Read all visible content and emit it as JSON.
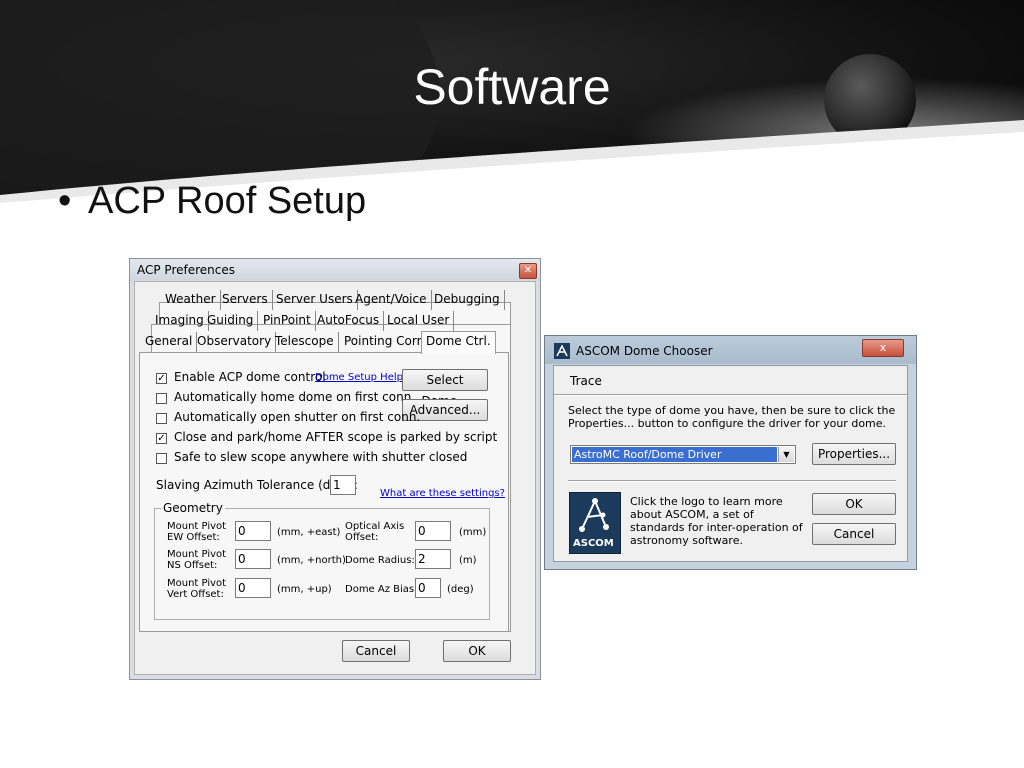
{
  "slide": {
    "title": "Software",
    "bullet": "ACP Roof Setup"
  },
  "acp": {
    "title": "ACP Preferences",
    "close_glyph": "✕",
    "tabs_row1": [
      "Weather",
      "Servers",
      "Server Users",
      "Agent/Voice",
      "Debugging"
    ],
    "tabs_row2": [
      "Imaging",
      "Guiding",
      "PinPoint",
      "AutoFocus",
      "Local User"
    ],
    "tabs_row3": [
      "General",
      "Observatory",
      "Telescope",
      "Pointing Corr.",
      "Dome Ctrl."
    ],
    "active_tab": "Dome Ctrl.",
    "options": [
      {
        "label": "Enable ACP dome control",
        "checked": true,
        "mark": "✓"
      },
      {
        "label": "Automatically home dome on first conn.",
        "checked": false,
        "mark": ""
      },
      {
        "label": "Automatically open shutter on first conn.",
        "checked": false,
        "mark": ""
      },
      {
        "label": "Close and park/home AFTER scope is parked by script",
        "checked": true,
        "mark": "✓"
      },
      {
        "label": "Safe to slew scope anywhere with shutter closed",
        "checked": false,
        "mark": ""
      }
    ],
    "dome_setup_help": "Dome Setup Help",
    "select_dome_button": "Select Dome...",
    "advanced_button": "Advanced...",
    "slaving_label": "Slaving Azimuth Tolerance (deg.):",
    "slaving_value": "1",
    "settings_link": "What are these settings?",
    "geometry": {
      "legend": "Geometry",
      "ew_label_1": "Mount Pivot",
      "ew_label_2": "EW Offset:",
      "ew_value": "0",
      "ew_unit": "(mm, +east)",
      "ns_label_1": "Mount Pivot",
      "ns_label_2": "NS Offset:",
      "ns_value": "0",
      "ns_unit": "(mm, +north)",
      "vert_label_1": "Mount Pivot",
      "vert_label_2": "Vert Offset:",
      "vert_value": "0",
      "vert_unit": "(mm, +up)",
      "axis_label_1": "Optical Axis",
      "axis_label_2": "Offset:",
      "axis_value": "0",
      "axis_unit": "(mm)",
      "radius_label": "Dome Radius:",
      "radius_value": "2",
      "radius_unit": "(m)",
      "bias_label": "Dome Az Bias:",
      "bias_value": "0",
      "bias_unit": "(deg)"
    },
    "cancel_button": "Cancel",
    "ok_button": "OK"
  },
  "ascom": {
    "title": "ASCOM Dome Chooser",
    "close_glyph": "x",
    "menu_trace": "Trace",
    "instructions_1": "Select the type of dome you have, then be sure to click the",
    "instructions_2": "Properties... button to configure the driver for your dome.",
    "driver_selected": "AstroMC Roof/Dome Driver",
    "dropdown_arrow": "▼",
    "properties_button": "Properties...",
    "logo_text": "ASCOM",
    "info_1": "Click the logo to learn more",
    "info_2": "about ASCOM, a set of",
    "info_3": "standards for inter-operation of",
    "info_4": "astronomy software.",
    "ok_button": "OK",
    "cancel_button": "Cancel"
  }
}
